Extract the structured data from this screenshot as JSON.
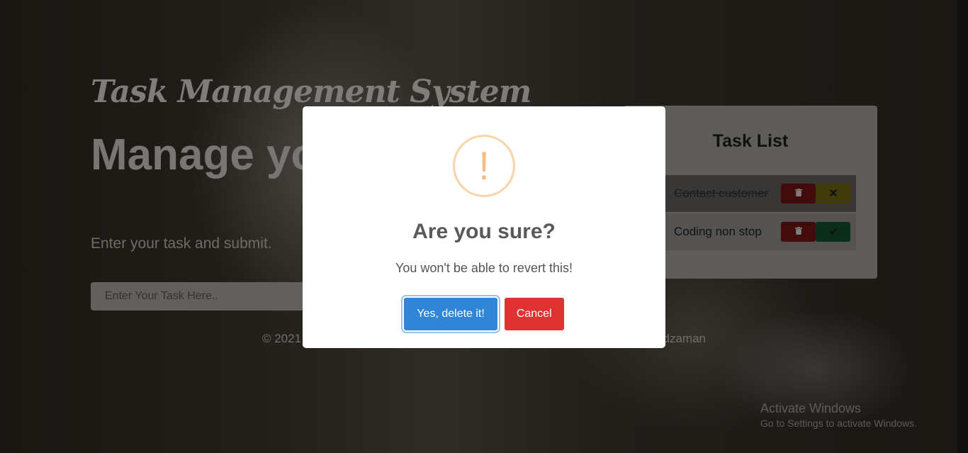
{
  "page": {
    "brand": "Task Management System",
    "headline": "Manage your task.",
    "subline": "Enter your task and submit.",
    "task_input": {
      "placeholder": "Enter Your Task Here..",
      "value": ""
    },
    "footer_left": "© 2021",
    "footer_right": "dzaman"
  },
  "task_list": {
    "title": "Task List",
    "items": [
      {
        "text": "Contact customer",
        "status": "completed",
        "delete_icon": "trash-icon",
        "action_icon": "times-icon"
      },
      {
        "text": "Coding non stop",
        "status": "pending",
        "delete_icon": "trash-icon",
        "action_icon": "check-icon"
      }
    ]
  },
  "modal": {
    "icon": "warning-icon",
    "icon_glyph": "!",
    "title": "Are you sure?",
    "text": "You won't be able to revert this!",
    "confirm_label": "Yes, delete it!",
    "cancel_label": "Cancel",
    "colors": {
      "confirm": "#3085d6",
      "cancel": "#dd3333",
      "warning": "#f8bb86"
    }
  },
  "windows_watermark": {
    "line1": "Activate Windows",
    "line2": "Go to Settings to activate Windows."
  }
}
